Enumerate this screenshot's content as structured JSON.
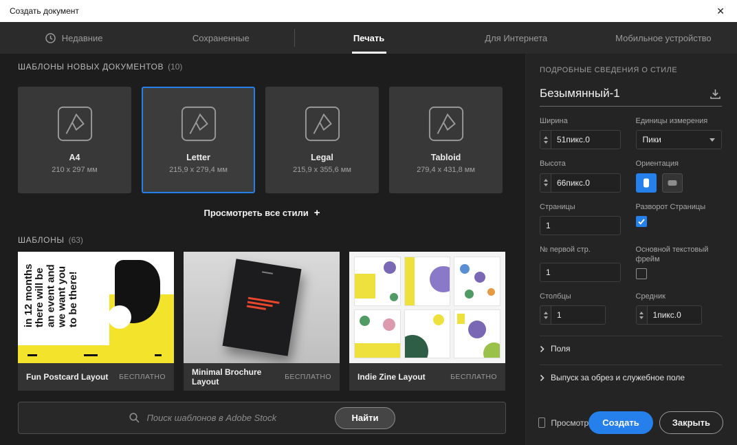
{
  "window": {
    "title": "Создать документ"
  },
  "icons": {
    "close": "✕",
    "plus": "+"
  },
  "colors": {
    "accent": "#2680eb",
    "selection_border": "#2680eb",
    "template_yellow": "#f3e32b"
  },
  "tabs": [
    {
      "label": "Недавние",
      "active": false
    },
    {
      "label": "Сохраненные",
      "active": false
    },
    {
      "label": "Печать",
      "active": true
    },
    {
      "label": "Для Интернета",
      "active": false
    },
    {
      "label": "Мобильное устройство",
      "active": false
    }
  ],
  "presets": {
    "section_title": "ШАБЛОНЫ НОВЫХ ДОКУМЕНТОВ",
    "section_count": "(10)",
    "view_all_label": "Просмотреть все стили",
    "items": [
      {
        "name": "A4",
        "size": "210 x 297 мм",
        "selected": false
      },
      {
        "name": "Letter",
        "size": "215,9 x 279,4 мм",
        "selected": true
      },
      {
        "name": "Legal",
        "size": "215,9 x 355,6 мм",
        "selected": false
      },
      {
        "name": "Tabloid",
        "size": "279,4 x 431,8 мм",
        "selected": false
      }
    ]
  },
  "templates": {
    "section_title": "ШАБЛОНЫ",
    "section_count": "(63)",
    "items": [
      {
        "name": "Fun Postcard Layout",
        "price": "БЕСПЛАТНО",
        "art_text": "in 12 months there will be an event and we want you to be there!"
      },
      {
        "name": "Minimal Brochure Layout",
        "price": "БЕСПЛАТНО"
      },
      {
        "name": "Indie Zine Layout",
        "price": "БЕСПЛАТНО"
      }
    ]
  },
  "search": {
    "placeholder": "Поиск шаблонов в Adobe Stock",
    "button_label": "Найти"
  },
  "details": {
    "header": "ПОДРОБНЫЕ СВЕДЕНИЯ О СТИЛЕ",
    "doc_name": "Безымянный-1",
    "width": {
      "label": "Ширина",
      "value": "51пикс.0"
    },
    "units": {
      "label": "Единицы измерения",
      "value": "Пики"
    },
    "height": {
      "label": "Высота",
      "value": "66пикс.0"
    },
    "orientation": {
      "label": "Ориентация"
    },
    "pages": {
      "label": "Страницы",
      "value": "1"
    },
    "facing_pages": {
      "label": "Разворот Страницы",
      "checked": true
    },
    "start_page": {
      "label": "№ первой стр.",
      "value": "1"
    },
    "primary_text_frame": {
      "label": "Основной текстовый фрейм",
      "checked": false
    },
    "columns": {
      "label": "Столбцы",
      "value": "1"
    },
    "gutter": {
      "label": "Средник",
      "value": "1пикс.0"
    },
    "sections": {
      "margins": "Поля",
      "bleed": "Выпуск за обрез и служебное поле"
    },
    "preview_label": "Просмотр",
    "create_label": "Создать",
    "close_label": "Закрыть"
  }
}
